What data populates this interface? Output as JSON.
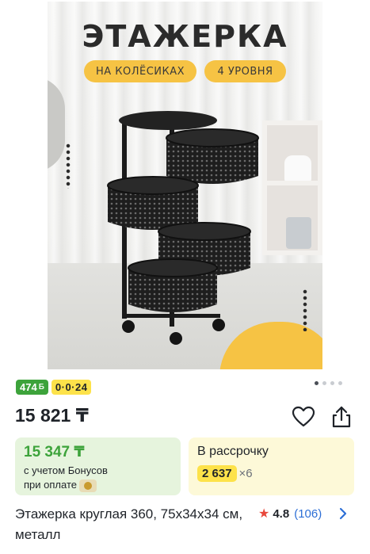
{
  "product_image": {
    "title": "ЭТАЖЕРКА",
    "chip_wheels": "НА КОЛЁСИКАХ",
    "chip_levels": "4 УРОВНЯ"
  },
  "gallery": {
    "pages": 4,
    "active_index": 0
  },
  "badges": {
    "bonus": "474",
    "bonus_symbol": "Б",
    "installment_plan": "0·0·24"
  },
  "price": "15 821 ₸",
  "bonus_card": {
    "price": "15 347 ₸",
    "line1": "с учетом Бонусов",
    "line2": "при оплате"
  },
  "installment_card": {
    "label": "В рассрочку",
    "amount": "2 637",
    "multiplier": "×6"
  },
  "product": {
    "title": "Этажерка круглая 360, 75x34x34 см, металл",
    "rating": "4.8",
    "reviews": "(106)"
  },
  "colors": {
    "accent_green": "#3da33b",
    "accent_yellow": "#fde24a",
    "link_blue": "#2d6fd6",
    "star_red": "#e8473b"
  }
}
